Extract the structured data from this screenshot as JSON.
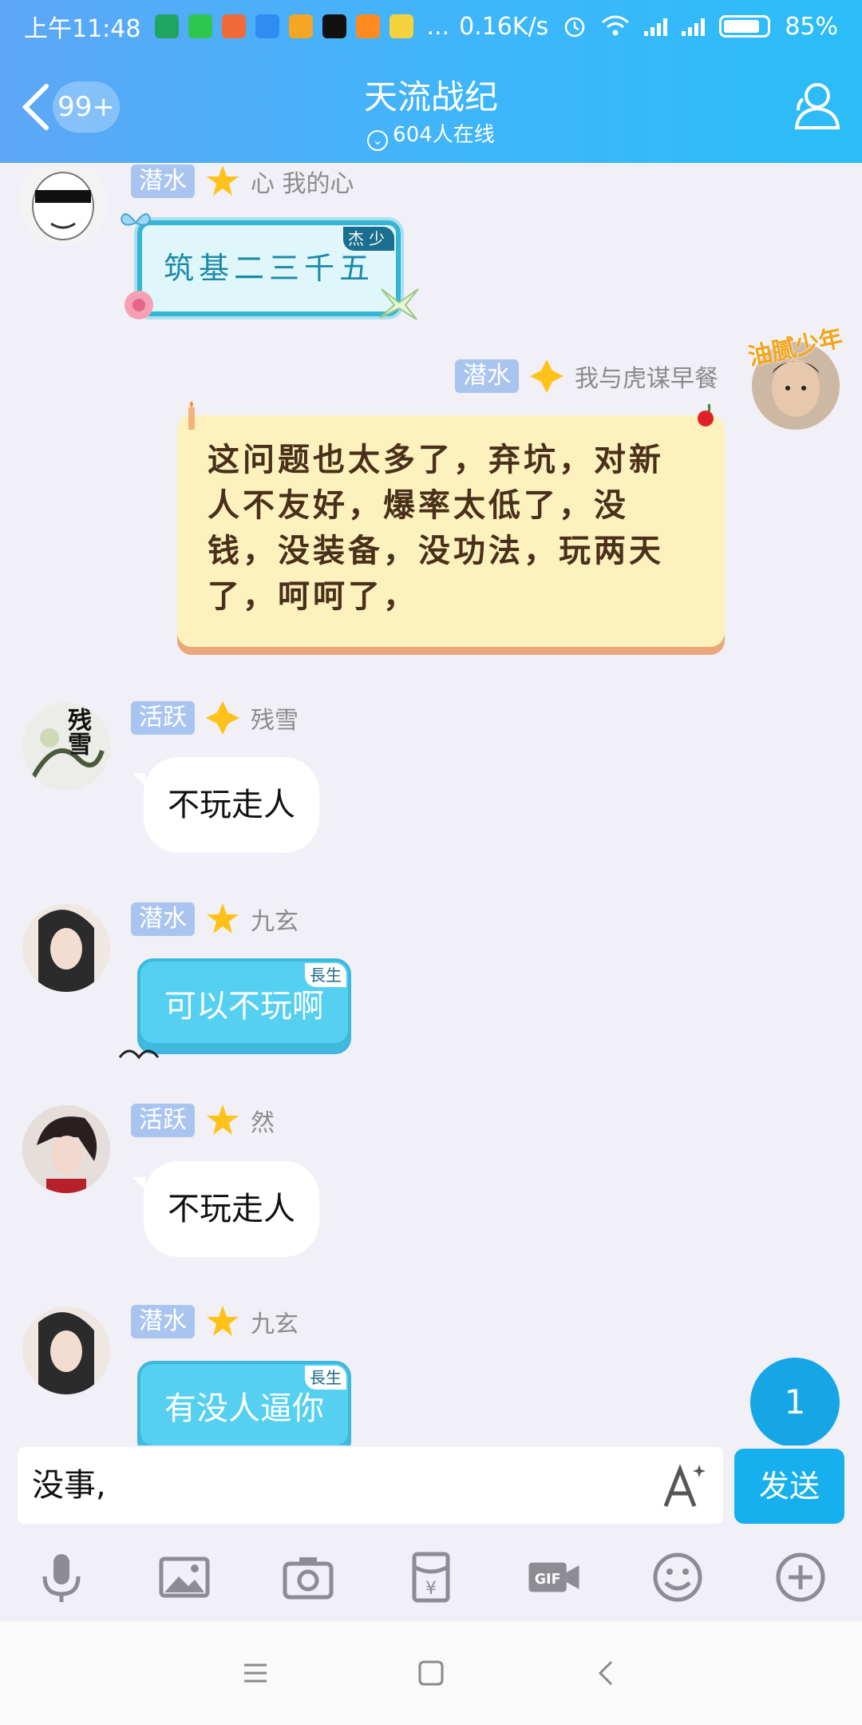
{
  "status_bar": {
    "time": "上午11:48",
    "net_speed": "0.16K/s",
    "battery": "85%",
    "battery_level": 0.85,
    "overflow": "..."
  },
  "header": {
    "back_badge": "99+",
    "title": "天流战纪",
    "online": "604人在线"
  },
  "messages": [
    {
      "tag": "潜水",
      "name": "心 我的心",
      "text": "筑基二三千五",
      "corner": "杰少",
      "style": "card-cyan",
      "side": "left"
    },
    {
      "tag": "潜水",
      "name": "我与虎谋早餐",
      "text": "这问题也太多了，弃坑，对新人不友好，爆率太低了，没钱，没装备，没功法，玩两天了，呵呵了，",
      "side": "right",
      "style": "card-yellow",
      "avatar_caption": "油腻少年"
    },
    {
      "tag": "活跃",
      "name": "残雪",
      "text": "不玩走人",
      "style": "white",
      "side": "left",
      "avatar_caption": "残雪"
    },
    {
      "tag": "潜水",
      "name": "九玄",
      "text": "可以不玩啊",
      "corner": "長生",
      "style": "blue",
      "side": "left"
    },
    {
      "tag": "活跃",
      "name": "然",
      "text": "不玩走人",
      "style": "white",
      "side": "left"
    },
    {
      "tag": "潜水",
      "name": "九玄",
      "text": "有没人逼你",
      "corner": "長生",
      "style": "blue",
      "side": "left"
    }
  ],
  "unread_count": "1",
  "composer": {
    "text": "没事,",
    "send_label": "发送"
  },
  "toolbar_icons": [
    "microphone-icon",
    "image-icon",
    "camera-icon",
    "red-packet-icon",
    "gif-icon",
    "emoji-icon",
    "plus-icon"
  ],
  "colors": {
    "header_start": "#5da7f6",
    "header_end": "#2bbdf8",
    "send_button": "#17b0ee",
    "tag_bg": "#a9c5ef",
    "blue_bubble": "#55d0f1",
    "yellow_bubble": "#fdf2bd"
  }
}
